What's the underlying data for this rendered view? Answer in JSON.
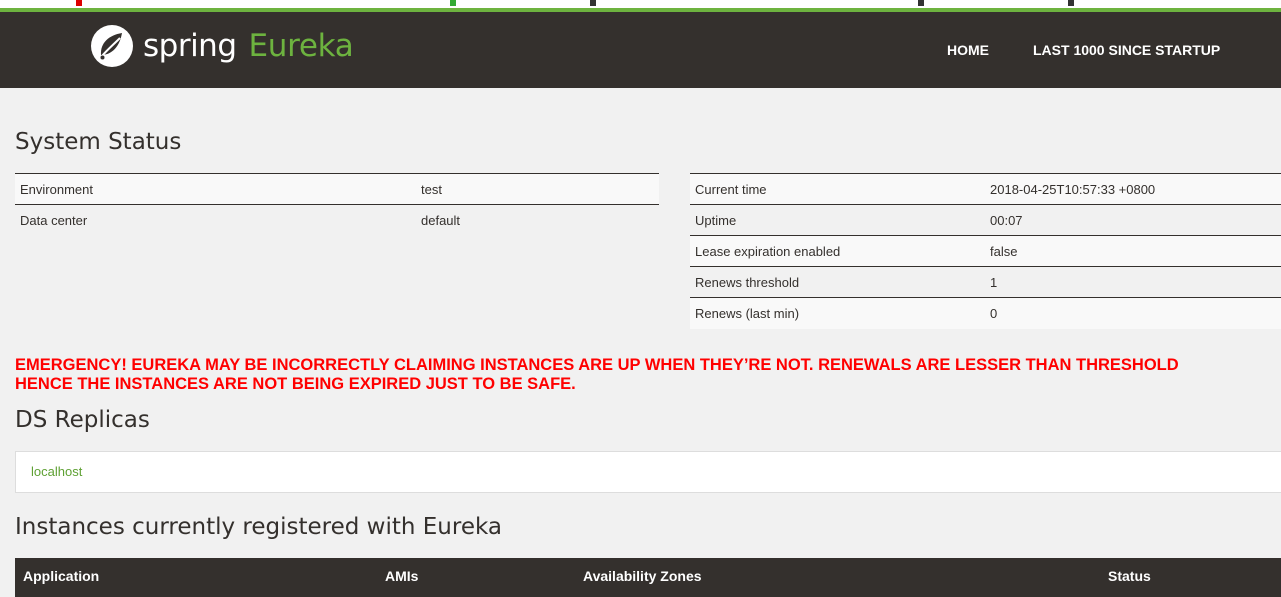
{
  "colors": {
    "navbar": "#34302d",
    "brand_green": "#6db33f",
    "emergency": "#ff0000",
    "background": "#f1f1f1"
  },
  "header": {
    "logo_icon": "spring-leaf-icon",
    "brand_word": "spring",
    "brand_product": "Eureka",
    "nav": [
      {
        "label": "HOME"
      },
      {
        "label": "LAST 1000 SINCE STARTUP"
      }
    ]
  },
  "system_status": {
    "title": "System Status",
    "left_table": [
      {
        "key": "Environment",
        "value": "test"
      },
      {
        "key": "Data center",
        "value": "default"
      }
    ],
    "right_table": [
      {
        "key": "Current time",
        "value": "2018-04-25T10:57:33 +0800"
      },
      {
        "key": "Uptime",
        "value": "00:07"
      },
      {
        "key": "Lease expiration enabled",
        "value": "false"
      },
      {
        "key": "Renews threshold",
        "value": "1"
      },
      {
        "key": "Renews (last min)",
        "value": "0"
      }
    ]
  },
  "emergency": {
    "line1": "EMERGENCY! EUREKA MAY BE INCORRECTLY CLAIMING INSTANCES ARE UP WHEN THEY’RE NOT. RENEWALS ARE LESSER THAN THRESHOLD",
    "line2": "HENCE THE INSTANCES ARE NOT BEING EXPIRED JUST TO BE SAFE."
  },
  "replicas": {
    "title": "DS Replicas",
    "items": [
      {
        "label": "localhost"
      }
    ]
  },
  "instances": {
    "title": "Instances currently registered with Eureka",
    "columns": [
      "Application",
      "AMIs",
      "Availability Zones",
      "Status"
    ]
  }
}
